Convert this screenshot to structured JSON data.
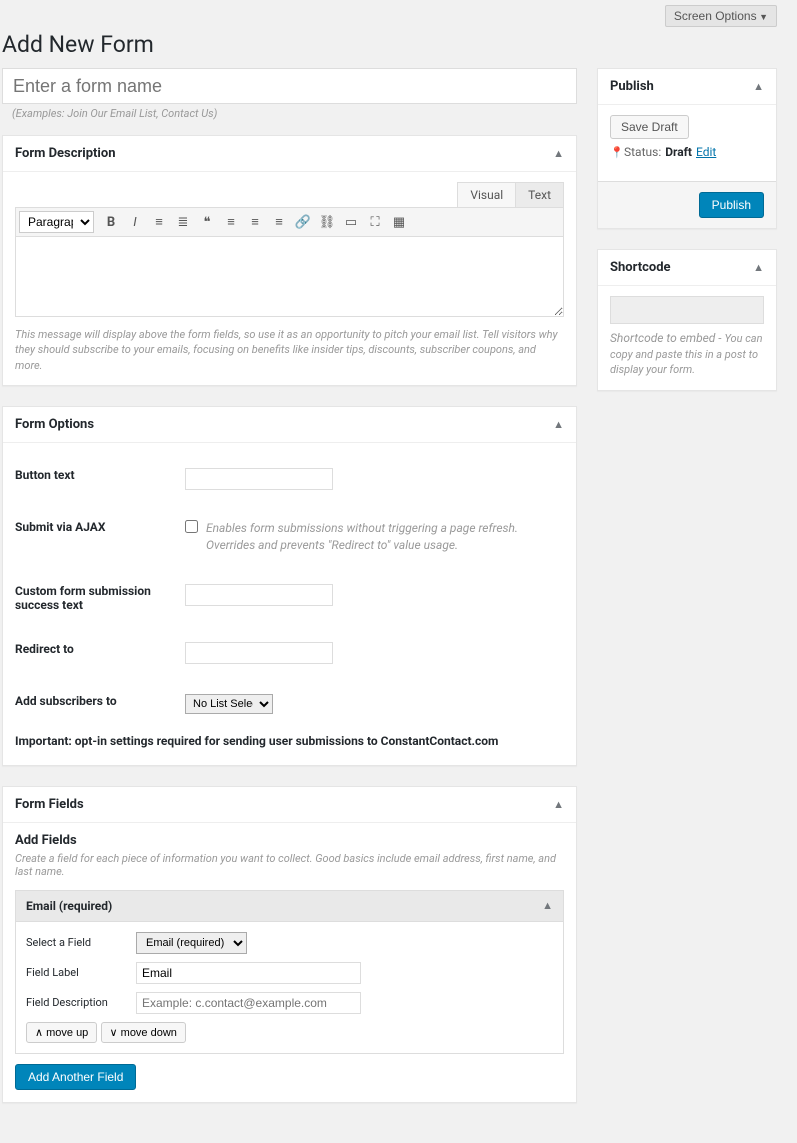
{
  "screen_options_label": "Screen Options",
  "page_title": "Add New Form",
  "title_input": {
    "placeholder": "Enter a form name",
    "hint": "(Examples: Join Our Email List, Contact Us)"
  },
  "description_box": {
    "title": "Form Description",
    "tabs": {
      "visual": "Visual",
      "text": "Text"
    },
    "format_select": "Paragraph",
    "hint": "This message will display above the form fields, so use it as an opportunity to pitch your email list. Tell visitors why they should subscribe to your emails, focusing on benefits like insider tips, discounts, subscriber coupons, and more."
  },
  "options_box": {
    "title": "Form Options",
    "button_text_label": "Button text",
    "ajax_label": "Submit via AJAX",
    "ajax_desc": "Enables form submissions without triggering a page refresh. Overrides and prevents \"Redirect to\" value usage.",
    "success_text_label": "Custom form submission success text",
    "redirect_label": "Redirect to",
    "add_subscribers_label": "Add subscribers to",
    "list_selected": "No List Selected",
    "important_note": "Important: opt-in settings required for sending user submissions to ConstantContact.com"
  },
  "fields_box": {
    "title": "Form Fields",
    "add_fields_heading": "Add Fields",
    "add_fields_desc": "Create a field for each piece of information you want to collect. Good basics include email address, first name, and last name.",
    "field": {
      "header": "Email (required)",
      "select_label": "Select a Field",
      "select_value": "Email (required)",
      "label_label": "Field Label",
      "label_value": "Email",
      "desc_label": "Field Description",
      "desc_placeholder": "Example: c.contact@example.com",
      "move_up": "move up",
      "move_down": "move down"
    },
    "add_another": "Add Another Field"
  },
  "publish_box": {
    "title": "Publish",
    "save_draft": "Save Draft",
    "status_label": "Status:",
    "status_value": "Draft",
    "edit_link": "Edit",
    "publish_btn": "Publish"
  },
  "shortcode_box": {
    "title": "Shortcode",
    "desc_lead": "Shortcode to embed - ",
    "desc_rest": "You can copy and paste this in a post to display your form."
  }
}
